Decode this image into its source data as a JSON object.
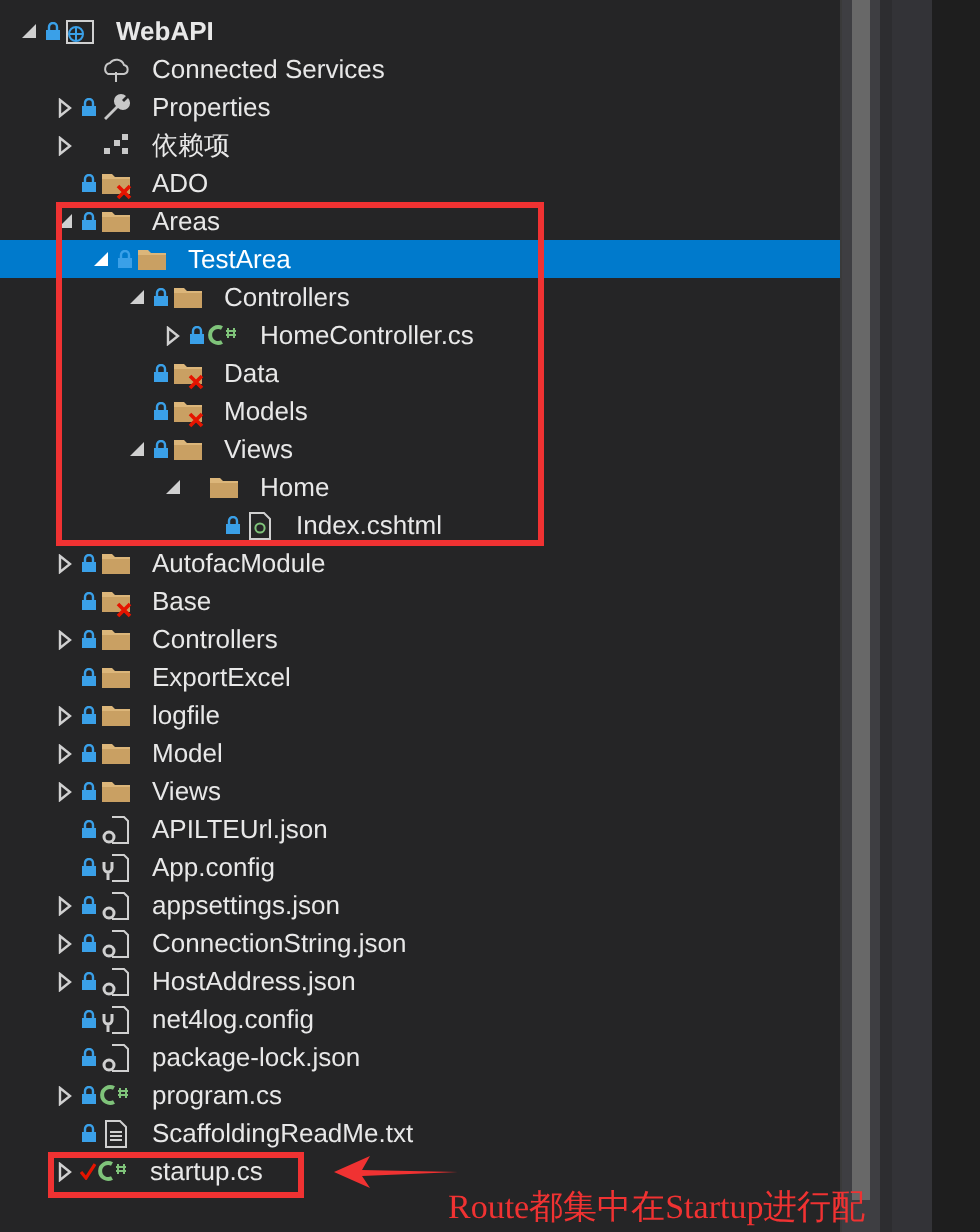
{
  "tree": [
    {
      "label": "WebAPI",
      "kind": "project",
      "locked": true,
      "expanded": true,
      "selected": false,
      "children": [
        {
          "label": "Connected Services",
          "kind": "connected",
          "selected": false
        },
        {
          "label": "Properties",
          "kind": "wrench",
          "locked": true,
          "expanded": false,
          "selected": false
        },
        {
          "label": "依赖项",
          "kind": "deps",
          "expanded": false,
          "selected": false
        },
        {
          "label": "ADO",
          "kind": "folder-excluded",
          "locked": true,
          "selected": false
        },
        {
          "label": "Areas",
          "kind": "folder",
          "locked": true,
          "expanded": true,
          "selected": false,
          "children": [
            {
              "label": "TestArea",
              "kind": "folder",
              "locked": true,
              "expanded": true,
              "selected": true,
              "children": [
                {
                  "label": "Controllers",
                  "kind": "folder",
                  "locked": true,
                  "expanded": true,
                  "selected": false,
                  "children": [
                    {
                      "label": "HomeController.cs",
                      "kind": "csharp",
                      "locked": true,
                      "expanded": false,
                      "selected": false
                    }
                  ]
                },
                {
                  "label": "Data",
                  "kind": "folder-excluded",
                  "locked": true,
                  "selected": false
                },
                {
                  "label": "Models",
                  "kind": "folder-excluded",
                  "locked": true,
                  "selected": false
                },
                {
                  "label": "Views",
                  "kind": "folder",
                  "locked": true,
                  "expanded": true,
                  "selected": false,
                  "children": [
                    {
                      "label": "Home",
                      "kind": "folder",
                      "expanded": true,
                      "selected": false,
                      "children": [
                        {
                          "label": "Index.cshtml",
                          "kind": "cshtml",
                          "locked": true,
                          "selected": false
                        }
                      ]
                    }
                  ]
                }
              ]
            }
          ]
        },
        {
          "label": "AutofacModule",
          "kind": "folder",
          "locked": true,
          "expanded": false,
          "selected": false
        },
        {
          "label": "Base",
          "kind": "folder-excluded",
          "locked": true,
          "selected": false
        },
        {
          "label": "Controllers",
          "kind": "folder",
          "locked": true,
          "expanded": false,
          "selected": false
        },
        {
          "label": "ExportExcel",
          "kind": "folder",
          "locked": true,
          "selected": false
        },
        {
          "label": "logfile",
          "kind": "folder",
          "locked": true,
          "expanded": false,
          "selected": false
        },
        {
          "label": "Model",
          "kind": "folder",
          "locked": true,
          "expanded": false,
          "selected": false
        },
        {
          "label": "Views",
          "kind": "folder",
          "locked": true,
          "expanded": false,
          "selected": false
        },
        {
          "label": "APILTEUrl.json",
          "kind": "json",
          "locked": true,
          "selected": false
        },
        {
          "label": "App.config",
          "kind": "config",
          "locked": true,
          "selected": false
        },
        {
          "label": "appsettings.json",
          "kind": "json",
          "locked": true,
          "expanded": false,
          "selected": false
        },
        {
          "label": "ConnectionString.json",
          "kind": "json",
          "locked": true,
          "expanded": false,
          "selected": false
        },
        {
          "label": "HostAddress.json",
          "kind": "json",
          "locked": true,
          "expanded": false,
          "selected": false
        },
        {
          "label": "net4log.config",
          "kind": "config",
          "locked": true,
          "selected": false
        },
        {
          "label": "package-lock.json",
          "kind": "json",
          "locked": true,
          "selected": false
        },
        {
          "label": "program.cs",
          "kind": "csharp",
          "locked": true,
          "expanded": false,
          "selected": false
        },
        {
          "label": "ScaffoldingReadMe.txt",
          "kind": "txt",
          "locked": true,
          "selected": false
        },
        {
          "label": "startup.cs",
          "kind": "csharp",
          "checked_out": true,
          "expanded": false,
          "selected": false
        }
      ]
    }
  ],
  "annotation": {
    "note": "Route都集中在Startup进行配"
  }
}
